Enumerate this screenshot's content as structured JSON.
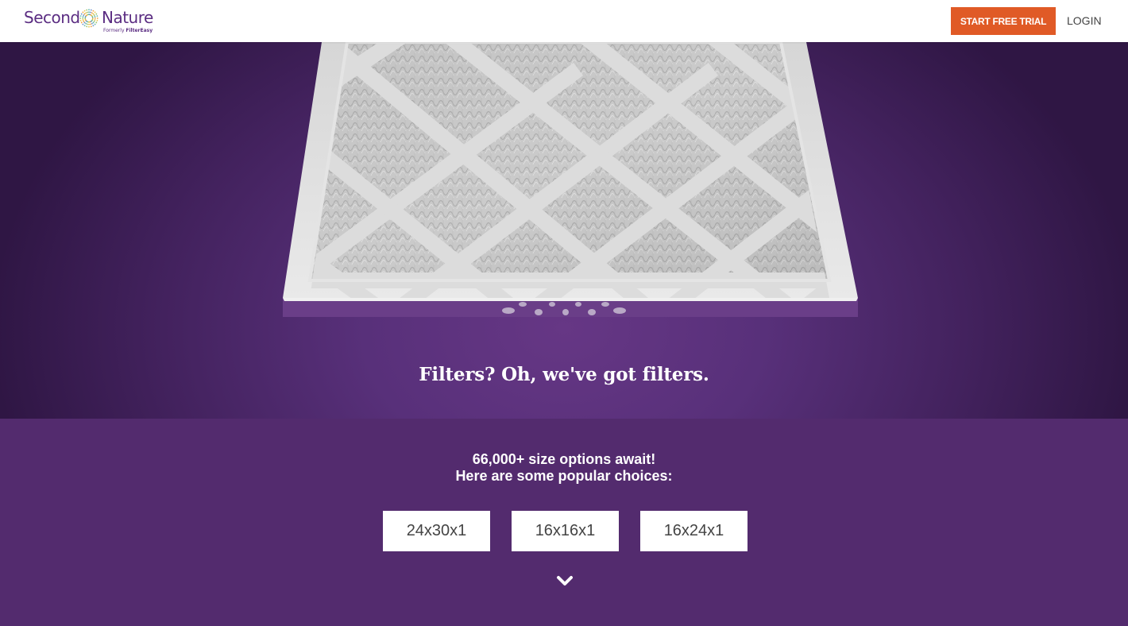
{
  "header": {
    "logo": {
      "word_first": "Second",
      "word_second": "Nature",
      "sub_prefix": "Formerly ",
      "sub_brand": "FilterEasy"
    },
    "cta_label": "START FREE TRIAL",
    "login_label": "LOGIN"
  },
  "hero": {
    "title": "Filters? Oh, we've got filters."
  },
  "sizes": {
    "line1": "66,000+ size options await!",
    "line2": "Here are some popular choices:",
    "options": [
      "24x30x1",
      "16x16x1",
      "16x24x1"
    ]
  },
  "icons": {
    "logo_mark": "sunburst-icon",
    "scroll": "chevron-down-icon"
  },
  "colors": {
    "brand_purple": "#5b2d82",
    "cta_orange": "#e05a26",
    "section_purple": "#532b6e"
  }
}
